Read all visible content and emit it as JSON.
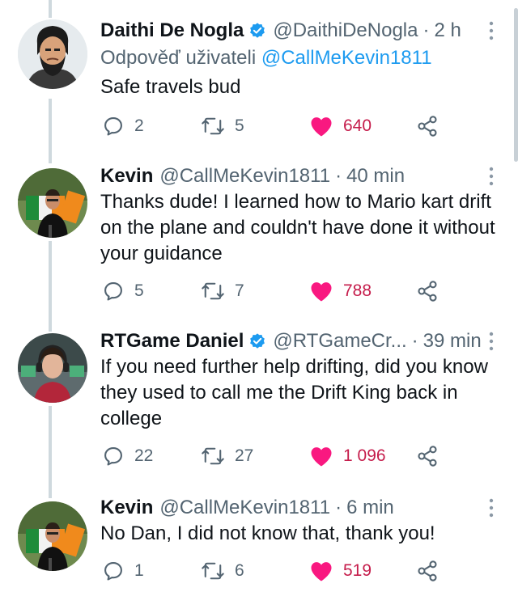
{
  "colors": {
    "accent": "#1d9bf0",
    "like": "#f91880",
    "muted": "#536471",
    "thread_line": "#cfd9de"
  },
  "tweets": [
    {
      "name": "Daithi De Nogla",
      "verified": true,
      "handle": "@DaithiDeNogla",
      "time": "2 h",
      "reply_prefix": "Odpověď uživateli",
      "reply_mention": "@CallMeKevin1811",
      "text": "Safe travels bud",
      "replies": "2",
      "retweets": "5",
      "likes": "640",
      "avatar_icon": "cartoon-bearded-man-avatar"
    },
    {
      "name": "Kevin",
      "verified": false,
      "handle": "@CallMeKevin1811",
      "time": "40 min",
      "text": "Thanks dude! I learned how to Mario kart drift on the plane and couldn't have done it without your guidance",
      "replies": "5",
      "retweets": "7",
      "likes": "788",
      "avatar_icon": "man-with-flag-photo-avatar"
    },
    {
      "name": "RTGame Daniel",
      "verified": true,
      "handle": "@RTGameCr...",
      "time": "39 min",
      "text": "If you need further help drifting, did you know they used to call me the Drift King back in college",
      "replies": "22",
      "retweets": "27",
      "likes": "1 096",
      "avatar_icon": "young-man-headphones-photo-avatar"
    },
    {
      "name": "Kevin",
      "verified": false,
      "handle": "@CallMeKevin1811",
      "time": "6 min",
      "text": "No Dan, I did not know that, thank you!",
      "replies": "1",
      "retweets": "6",
      "likes": "519",
      "avatar_icon": "man-with-flag-photo-avatar"
    }
  ]
}
